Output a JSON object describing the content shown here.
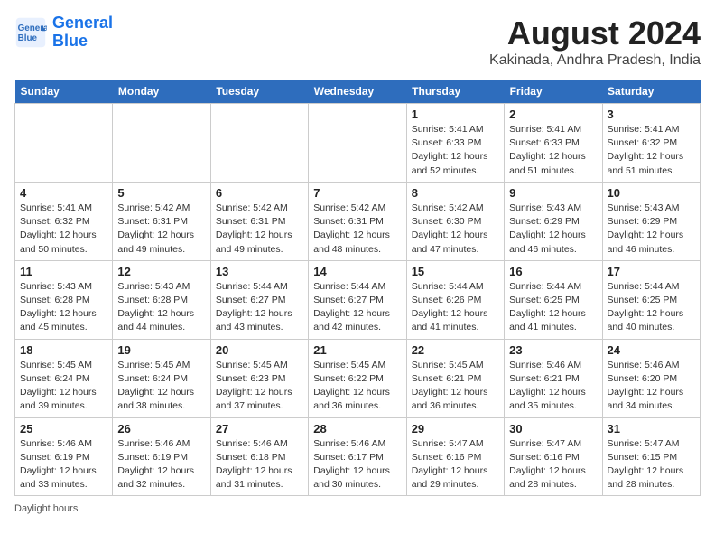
{
  "logo": {
    "line1": "General",
    "line2": "Blue"
  },
  "title": "August 2024",
  "subtitle": "Kakinada, Andhra Pradesh, India",
  "days_of_week": [
    "Sunday",
    "Monday",
    "Tuesday",
    "Wednesday",
    "Thursday",
    "Friday",
    "Saturday"
  ],
  "weeks": [
    [
      {
        "date": "",
        "info": ""
      },
      {
        "date": "",
        "info": ""
      },
      {
        "date": "",
        "info": ""
      },
      {
        "date": "",
        "info": ""
      },
      {
        "date": "1",
        "sunrise": "5:41 AM",
        "sunset": "6:33 PM",
        "daylight": "12 hours and 52 minutes."
      },
      {
        "date": "2",
        "sunrise": "5:41 AM",
        "sunset": "6:33 PM",
        "daylight": "12 hours and 51 minutes."
      },
      {
        "date": "3",
        "sunrise": "5:41 AM",
        "sunset": "6:32 PM",
        "daylight": "12 hours and 51 minutes."
      }
    ],
    [
      {
        "date": "4",
        "sunrise": "5:41 AM",
        "sunset": "6:32 PM",
        "daylight": "12 hours and 50 minutes."
      },
      {
        "date": "5",
        "sunrise": "5:42 AM",
        "sunset": "6:31 PM",
        "daylight": "12 hours and 49 minutes."
      },
      {
        "date": "6",
        "sunrise": "5:42 AM",
        "sunset": "6:31 PM",
        "daylight": "12 hours and 49 minutes."
      },
      {
        "date": "7",
        "sunrise": "5:42 AM",
        "sunset": "6:31 PM",
        "daylight": "12 hours and 48 minutes."
      },
      {
        "date": "8",
        "sunrise": "5:42 AM",
        "sunset": "6:30 PM",
        "daylight": "12 hours and 47 minutes."
      },
      {
        "date": "9",
        "sunrise": "5:43 AM",
        "sunset": "6:29 PM",
        "daylight": "12 hours and 46 minutes."
      },
      {
        "date": "10",
        "sunrise": "5:43 AM",
        "sunset": "6:29 PM",
        "daylight": "12 hours and 46 minutes."
      }
    ],
    [
      {
        "date": "11",
        "sunrise": "5:43 AM",
        "sunset": "6:28 PM",
        "daylight": "12 hours and 45 minutes."
      },
      {
        "date": "12",
        "sunrise": "5:43 AM",
        "sunset": "6:28 PM",
        "daylight": "12 hours and 44 minutes."
      },
      {
        "date": "13",
        "sunrise": "5:44 AM",
        "sunset": "6:27 PM",
        "daylight": "12 hours and 43 minutes."
      },
      {
        "date": "14",
        "sunrise": "5:44 AM",
        "sunset": "6:27 PM",
        "daylight": "12 hours and 42 minutes."
      },
      {
        "date": "15",
        "sunrise": "5:44 AM",
        "sunset": "6:26 PM",
        "daylight": "12 hours and 41 minutes."
      },
      {
        "date": "16",
        "sunrise": "5:44 AM",
        "sunset": "6:25 PM",
        "daylight": "12 hours and 41 minutes."
      },
      {
        "date": "17",
        "sunrise": "5:44 AM",
        "sunset": "6:25 PM",
        "daylight": "12 hours and 40 minutes."
      }
    ],
    [
      {
        "date": "18",
        "sunrise": "5:45 AM",
        "sunset": "6:24 PM",
        "daylight": "12 hours and 39 minutes."
      },
      {
        "date": "19",
        "sunrise": "5:45 AM",
        "sunset": "6:24 PM",
        "daylight": "12 hours and 38 minutes."
      },
      {
        "date": "20",
        "sunrise": "5:45 AM",
        "sunset": "6:23 PM",
        "daylight": "12 hours and 37 minutes."
      },
      {
        "date": "21",
        "sunrise": "5:45 AM",
        "sunset": "6:22 PM",
        "daylight": "12 hours and 36 minutes."
      },
      {
        "date": "22",
        "sunrise": "5:45 AM",
        "sunset": "6:21 PM",
        "daylight": "12 hours and 36 minutes."
      },
      {
        "date": "23",
        "sunrise": "5:46 AM",
        "sunset": "6:21 PM",
        "daylight": "12 hours and 35 minutes."
      },
      {
        "date": "24",
        "sunrise": "5:46 AM",
        "sunset": "6:20 PM",
        "daylight": "12 hours and 34 minutes."
      }
    ],
    [
      {
        "date": "25",
        "sunrise": "5:46 AM",
        "sunset": "6:19 PM",
        "daylight": "12 hours and 33 minutes."
      },
      {
        "date": "26",
        "sunrise": "5:46 AM",
        "sunset": "6:19 PM",
        "daylight": "12 hours and 32 minutes."
      },
      {
        "date": "27",
        "sunrise": "5:46 AM",
        "sunset": "6:18 PM",
        "daylight": "12 hours and 31 minutes."
      },
      {
        "date": "28",
        "sunrise": "5:46 AM",
        "sunset": "6:17 PM",
        "daylight": "12 hours and 30 minutes."
      },
      {
        "date": "29",
        "sunrise": "5:47 AM",
        "sunset": "6:16 PM",
        "daylight": "12 hours and 29 minutes."
      },
      {
        "date": "30",
        "sunrise": "5:47 AM",
        "sunset": "6:16 PM",
        "daylight": "12 hours and 28 minutes."
      },
      {
        "date": "31",
        "sunrise": "5:47 AM",
        "sunset": "6:15 PM",
        "daylight": "12 hours and 28 minutes."
      }
    ]
  ],
  "footer": {
    "daylight_label": "Daylight hours"
  }
}
